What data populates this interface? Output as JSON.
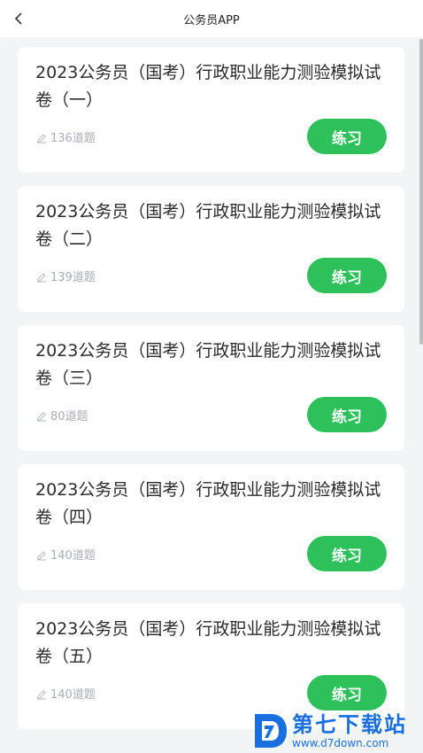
{
  "header": {
    "title": "公务员APP"
  },
  "papers": [
    {
      "title": "2023公务员（国考）行政职业能力测验模拟试卷（一）",
      "count": "136道题",
      "button": "练习"
    },
    {
      "title": "2023公务员（国考）行政职业能力测验模拟试卷（二）",
      "count": "139道题",
      "button": "练习"
    },
    {
      "title": "2023公务员（国考）行政职业能力测验模拟试卷（三）",
      "count": "80道题",
      "button": "练习"
    },
    {
      "title": "2023公务员（国考）行政职业能力测验模拟试卷（四）",
      "count": "140道题",
      "button": "练习"
    },
    {
      "title": "2023公务员（国考）行政职业能力测验模拟试卷（五）",
      "count": "140道题",
      "button": "练习"
    }
  ],
  "watermark": {
    "name": "第七下载站",
    "url": "www.d7down.com"
  },
  "icons": {
    "back": "chevron-left-icon",
    "count": "pencil-icon"
  },
  "colors": {
    "accent": "#2ec05a",
    "background": "#f3f4f6",
    "watermark": "#1a6fe0"
  }
}
